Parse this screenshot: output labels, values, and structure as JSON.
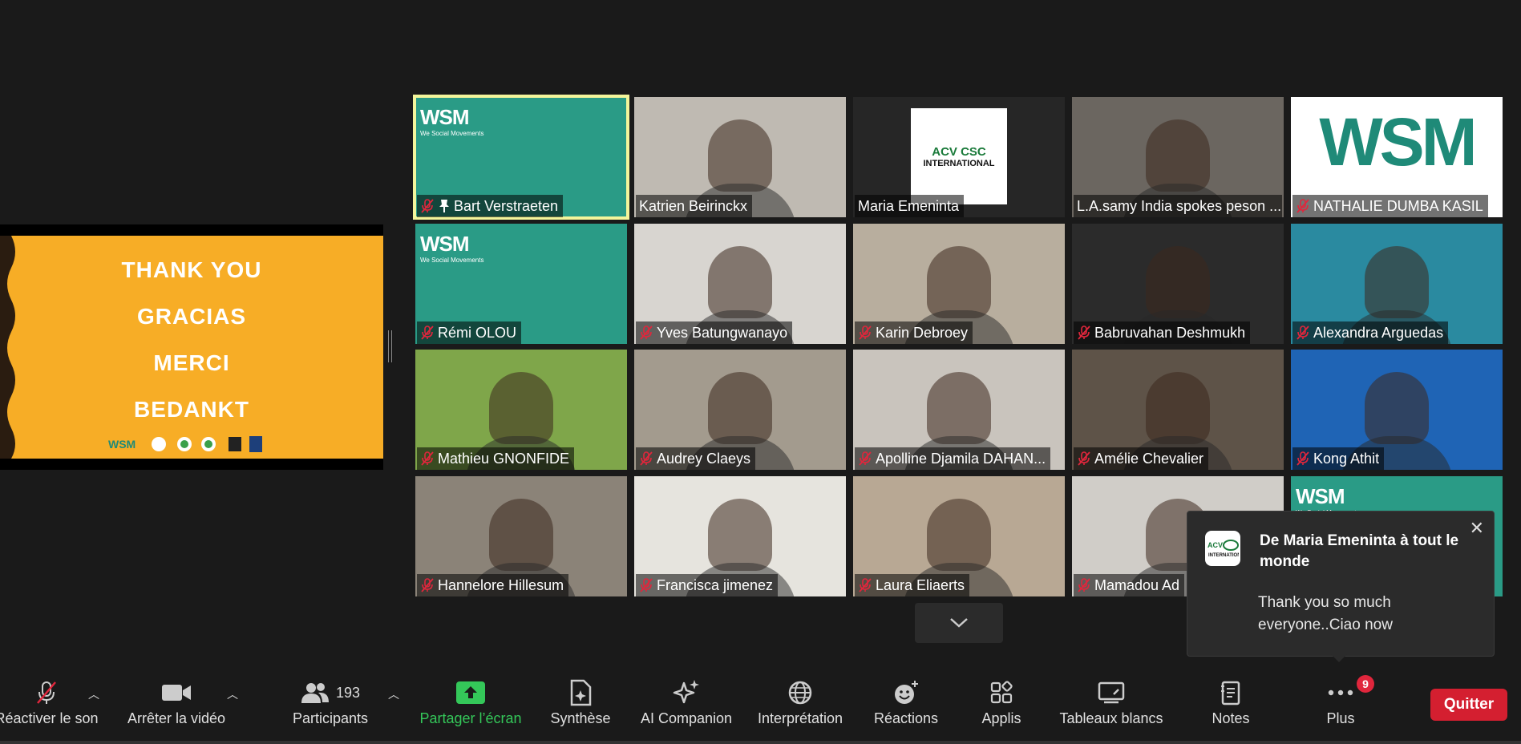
{
  "shared_slide": {
    "lines": [
      "THANK YOU",
      "GRACIAS",
      "MERCI",
      "BEDANKT"
    ],
    "background": "#f7ad26",
    "logos_caption": "WSM"
  },
  "participants": [
    {
      "name": "Bart Verstraeten",
      "muted": true,
      "pinned": true,
      "active": true,
      "bg": "#2a9b86",
      "wsm": true
    },
    {
      "name": "Katrien Beirinckx",
      "muted": false,
      "bg": "#bfbab2"
    },
    {
      "name": "Maria Emeninta",
      "muted": false,
      "bg": "#262626",
      "logo": "ACV CSC INTERNATIONAL"
    },
    {
      "name": "L.A.samy India spokes peson ...",
      "muted": false,
      "bg": "#6b6660"
    },
    {
      "name": "NATHALIE DUMBA KASIL",
      "muted": true,
      "bg": "#ffffff",
      "wsm_big": true
    },
    {
      "name": "Rémi OLOU",
      "muted": true,
      "bg": "#2a9b86",
      "wsm": true
    },
    {
      "name": "Yves Batungwanayo",
      "muted": true,
      "bg": "#d8d5d0"
    },
    {
      "name": "Karin Debroey",
      "muted": true,
      "bg": "#b8ae9e"
    },
    {
      "name": "Babruvahan Deshmukh",
      "muted": true,
      "bg": "#2b2b2b"
    },
    {
      "name": "Alexandra Arguedas",
      "muted": true,
      "bg": "#2a8aa0"
    },
    {
      "name": "Mathieu GNONFIDE",
      "muted": true,
      "bg": "#7fa64a"
    },
    {
      "name": "Audrey Claeys",
      "muted": true,
      "bg": "#a39b8e"
    },
    {
      "name": "Apolline Djamila DAHAN...",
      "muted": true,
      "bg": "#c9c4bd"
    },
    {
      "name": "Amélie Chevalier",
      "muted": true,
      "bg": "#5e5348"
    },
    {
      "name": "Kong Athit",
      "muted": true,
      "bg": "#1f64b5"
    },
    {
      "name": "Hannelore Hillesum",
      "muted": true,
      "bg": "#8b8378"
    },
    {
      "name": "Francisca jimenez",
      "muted": true,
      "bg": "#e6e4de"
    },
    {
      "name": "Laura Eliaerts",
      "muted": true,
      "bg": "#b8a894"
    },
    {
      "name": "Mamadou Ad",
      "muted": true,
      "bg": "#d0cdc8"
    },
    {
      "name": "",
      "muted": false,
      "bg": "#2a9b86",
      "wsm": true
    }
  ],
  "notification": {
    "title": "De Maria Emeninta à tout le monde",
    "message": "Thank you so much everyone..Ciao now"
  },
  "toolbar": {
    "mute_label": "Réactiver le son",
    "video_label": "Arrêter la vidéo",
    "participants_label": "Participants",
    "participants_count": "193",
    "share_label": "Partager l’écran",
    "summary_label": "Synthèse",
    "ai_label": "AI Companion",
    "interpretation_label": "Interprétation",
    "reactions_label": "Réactions",
    "apps_label": "Applis",
    "whiteboards_label": "Tableaux blancs",
    "notes_label": "Notes",
    "more_label": "Plus",
    "more_badge": "9",
    "quit_label": "Quitter"
  },
  "colors": {
    "active_speaker": "#f3f59b",
    "share_green": "#34c759",
    "quit_red": "#d41f30",
    "muted_red": "#e0263c"
  }
}
